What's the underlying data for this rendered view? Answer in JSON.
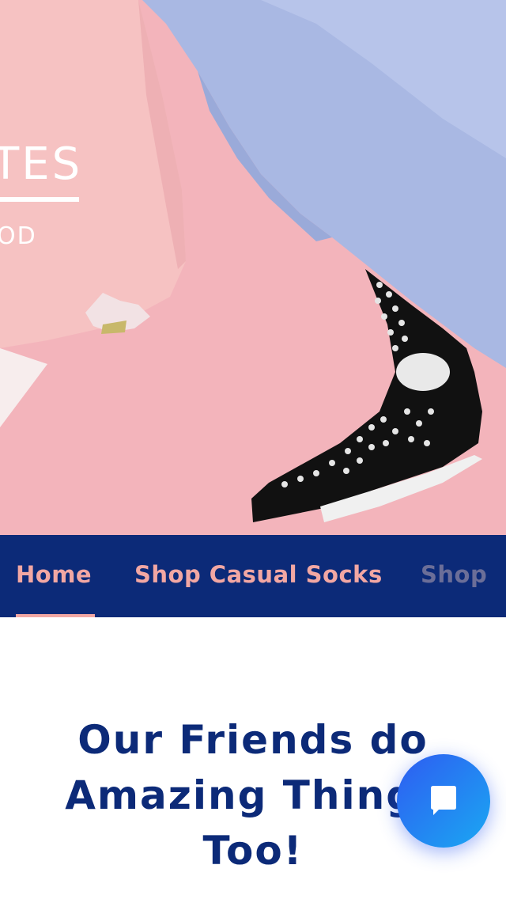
{
  "hero": {
    "title_fragment": "TES",
    "subtitle_fragment": "OD"
  },
  "nav": {
    "items": [
      {
        "label": "Home",
        "active": true
      },
      {
        "label": "Shop Casual Socks",
        "active": false
      },
      {
        "label": "Shop",
        "active": false
      }
    ]
  },
  "section": {
    "heading": "Our Friends do Amazing Things Too!"
  },
  "chat": {
    "icon": "chat-bubble-icon"
  },
  "colors": {
    "nav_background": "#0c2a78",
    "nav_text": "#f2a7a3",
    "heading_text": "#0c2a78",
    "hero_pink": "#f2b2ba",
    "hero_blue": "#a7b7e2"
  }
}
